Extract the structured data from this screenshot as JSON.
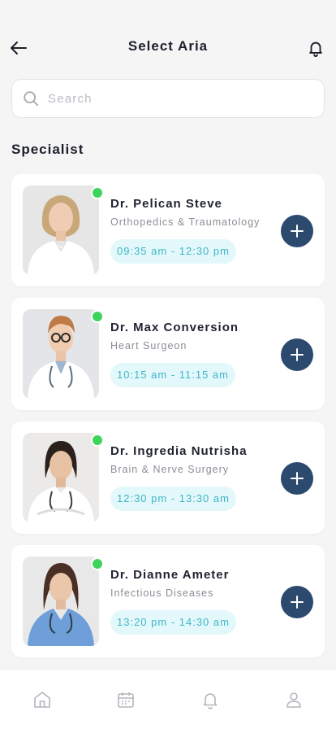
{
  "header": {
    "title": "Select Aria",
    "back_icon": "arrow-left-icon",
    "bell_icon": "bell-icon"
  },
  "search": {
    "placeholder": "Search",
    "value": ""
  },
  "section": {
    "title": "Specialist"
  },
  "colors": {
    "accent": "#2c4a6e",
    "online": "#3ed45c",
    "time_bg": "#e3f8fb",
    "time_text": "#3fb6c8"
  },
  "doctors": [
    {
      "name": "Dr. Pelican Steve",
      "specialty": "Orthopedics & Traumatology",
      "time": "09:35 am - 12:30 pm",
      "online": true
    },
    {
      "name": "Dr. Max Conversion",
      "specialty": "Heart Surgeon",
      "time": "10:15 am - 11:15 am",
      "online": true
    },
    {
      "name": "Dr. Ingredia Nutrisha",
      "specialty": "Brain & Nerve Surgery",
      "time": "12:30 pm - 13:30 am",
      "online": true
    },
    {
      "name": "Dr. Dianne Ameter",
      "specialty": "Infectious Diseases",
      "time": "13:20 pm - 14:30 am",
      "online": true
    }
  ],
  "bottom_nav": [
    {
      "icon": "home-icon"
    },
    {
      "icon": "calendar-icon"
    },
    {
      "icon": "bell-icon"
    },
    {
      "icon": "user-icon"
    }
  ]
}
